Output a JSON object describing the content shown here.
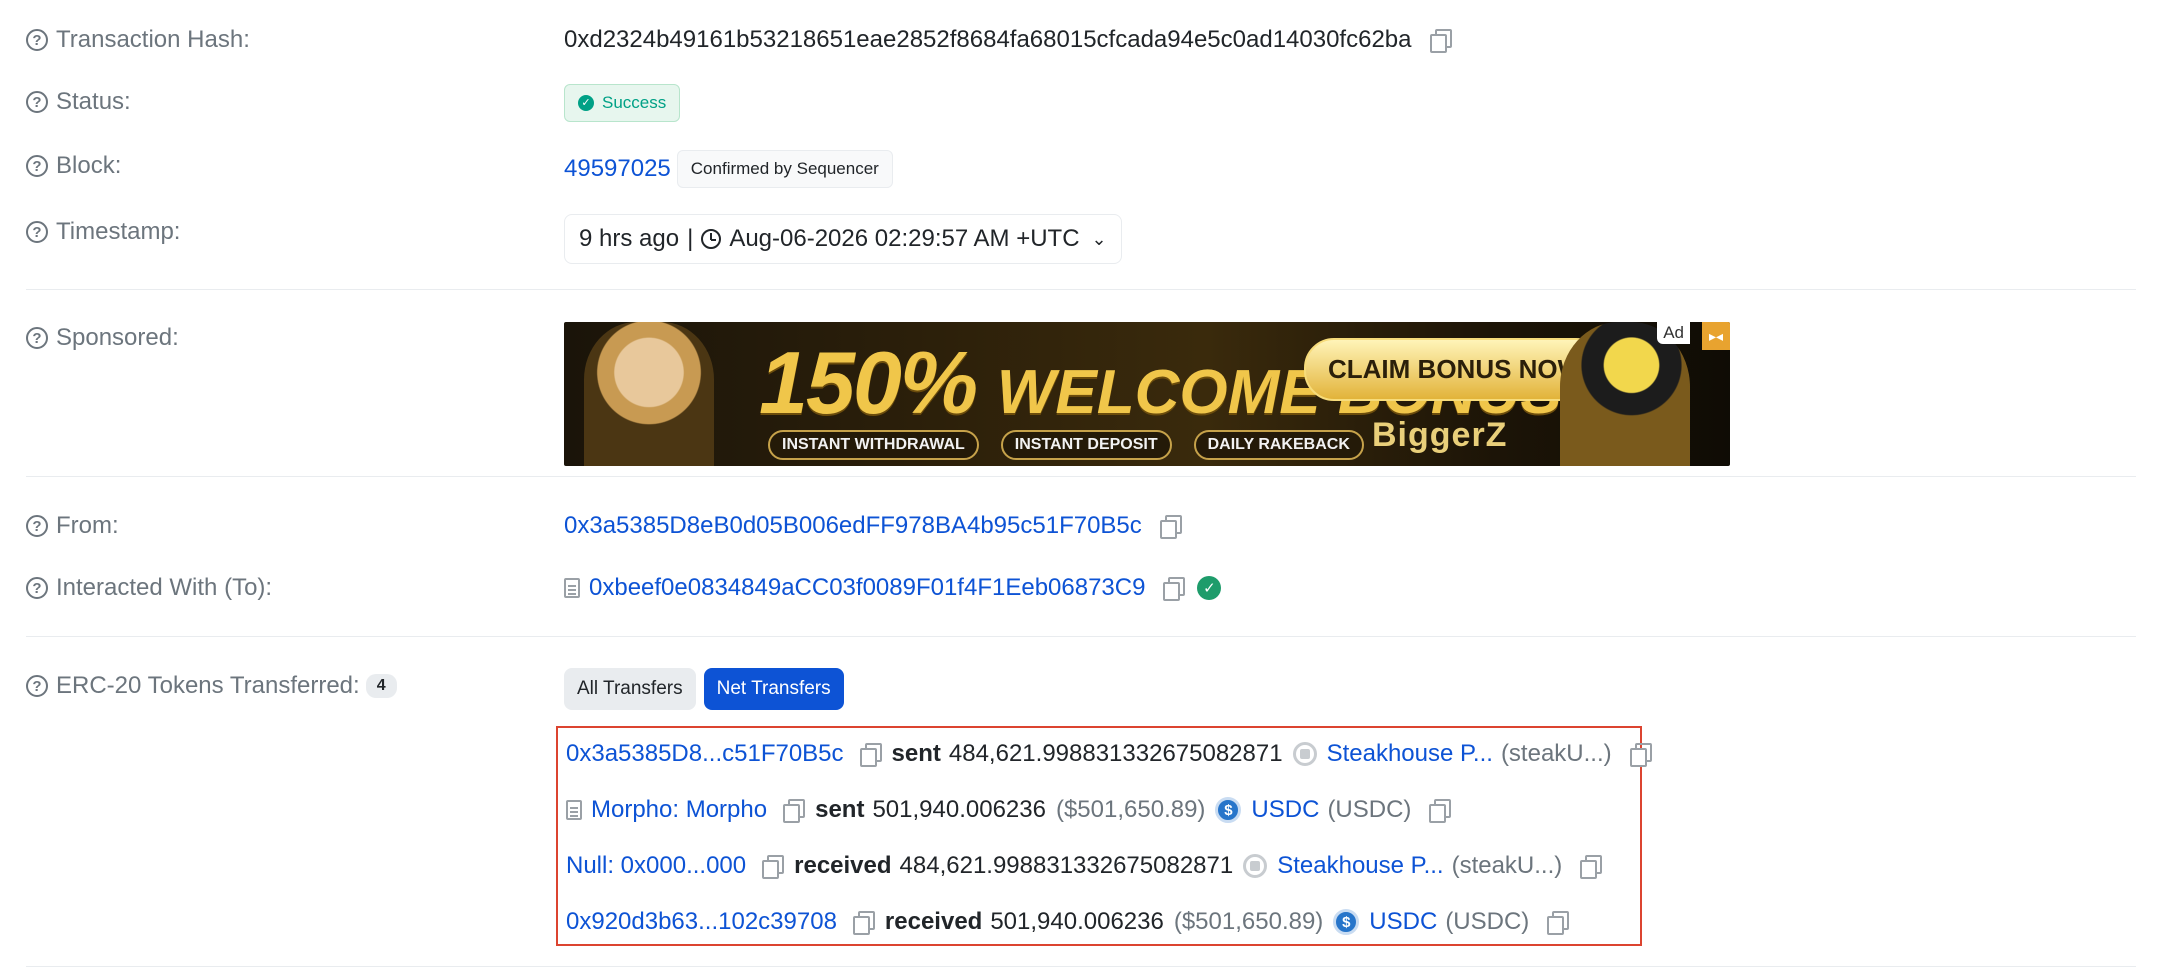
{
  "labels": {
    "tx_hash": "Transaction Hash:",
    "status": "Status:",
    "block": "Block:",
    "timestamp": "Timestamp:",
    "sponsored": "Sponsored:",
    "from": "From:",
    "to": "Interacted With (To):",
    "erc20": "ERC-20 Tokens Transferred:"
  },
  "tx_hash": "0xd2324b49161b53218651eae2852f8684fa68015cfcada94e5c0ad14030fc62ba",
  "status": "Success",
  "block": {
    "number": "49597025",
    "badge": "Confirmed by Sequencer"
  },
  "timestamp": {
    "relative": "9 hrs ago",
    "separator": "|",
    "absolute": "Aug-06-2026 02:29:57 AM +UTC"
  },
  "ad": {
    "headline_percent": "150%",
    "headline_text": "WELCOME BONUS",
    "cta": "CLAIM BONUS NOW",
    "pills": [
      "INSTANT WITHDRAWAL",
      "INSTANT DEPOSIT",
      "DAILY RAKEBACK"
    ],
    "brand": "BiggerZ",
    "tag": "Ad"
  },
  "from": "0x3a5385D8eB0d05B006edFF978BA4b95c51F70B5c",
  "to": "0xbeef0e0834849aCC03f0089F01f4F1Eeb06873C9",
  "erc20": {
    "count": "4",
    "tabs": [
      "All Transfers",
      "Net Transfers"
    ],
    "active_tab": "Net Transfers",
    "transfers": [
      {
        "address": "0x3a5385D8...c51F70B5c",
        "is_contract": false,
        "action": "sent",
        "amount": "484,621.998831332675082871",
        "usd": "",
        "token_name": "Steakhouse P...",
        "token_symbol": "(steakU...)",
        "token_icon": "generic-token"
      },
      {
        "address": "Morpho: Morpho",
        "is_contract": true,
        "action": "sent",
        "amount": "501,940.006236",
        "usd": "($501,650.89)",
        "token_name": "USDC",
        "token_symbol": "(USDC)",
        "token_icon": "usdc-token"
      },
      {
        "address": "Null: 0x000...000",
        "is_contract": false,
        "action": "received",
        "amount": "484,621.998831332675082871",
        "usd": "",
        "token_name": "Steakhouse P...",
        "token_symbol": "(steakU...)",
        "token_icon": "generic-token"
      },
      {
        "address": "0x920d3b63...102c39708",
        "is_contract": false,
        "action": "received",
        "amount": "501,940.006236",
        "usd": "($501,650.89)",
        "token_name": "USDC",
        "token_symbol": "(USDC)",
        "token_icon": "usdc-token"
      }
    ]
  },
  "colors": {
    "link": "#0d53d5",
    "success": "#00a186",
    "highlight_border": "#dc4430",
    "active_tab": "#0d53d5"
  }
}
